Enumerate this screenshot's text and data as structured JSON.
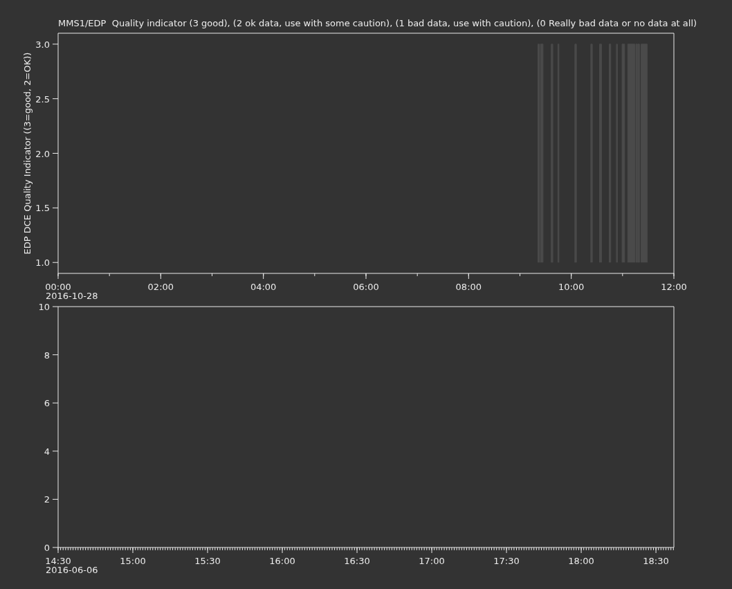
{
  "plots": [
    {
      "date_label": "2016-10-28",
      "chart_data": {
        "type": "line",
        "title": "MMS1/EDP  Quality indicator (3 good), (2 ok data, use with some caution), (1 bad data, use with caution), (0 Really bad data or no data at all)",
        "ylabel": "EDP DCE Quality Indicator ((3=good, 2=OK))",
        "xlim": [
          0,
          12
        ],
        "ylim": [
          0.9,
          3.1
        ],
        "x": [
          9.35,
          9.35,
          9.38,
          9.38,
          null,
          9.4,
          9.4,
          9.45,
          9.45,
          null,
          9.61,
          9.61,
          9.64,
          9.64,
          null,
          9.74,
          9.74,
          9.76,
          9.76,
          null,
          10.07,
          10.07,
          10.1,
          10.1,
          null,
          10.38,
          10.38,
          10.41,
          10.41,
          null,
          10.55,
          10.55,
          10.59,
          10.59,
          null,
          10.74,
          10.74,
          10.77,
          10.77,
          null,
          10.88,
          10.88,
          10.9,
          10.9,
          null,
          10.99,
          10.99,
          11.04,
          11.04,
          null,
          11.1,
          11.1,
          11.24,
          11.24,
          null,
          11.26,
          11.26,
          11.29,
          11.29,
          null,
          11.3,
          11.3,
          11.33,
          11.33,
          null,
          11.36,
          11.36,
          11.48,
          11.48
        ],
        "series": [
          {
            "color": "#4a4a4a",
            "values": [
              1,
              3,
              3,
              1,
              null,
              1,
              3,
              3,
              1,
              null,
              1,
              3,
              3,
              1,
              null,
              1,
              3,
              3,
              1,
              null,
              1,
              3,
              3,
              1,
              null,
              1,
              3,
              3,
              1,
              null,
              1,
              3,
              3,
              1,
              null,
              1,
              3,
              3,
              1,
              null,
              1,
              3,
              3,
              1,
              null,
              1,
              3,
              3,
              1,
              null,
              1,
              3,
              3,
              1,
              null,
              1,
              3,
              3,
              1,
              null,
              1,
              3,
              3,
              1,
              null,
              1,
              3,
              3,
              1
            ]
          }
        ],
        "xticks": [
          {
            "value": 0,
            "label": "00:00"
          },
          {
            "value": 2,
            "label": "02:00"
          },
          {
            "value": 4,
            "label": "04:00"
          },
          {
            "value": 6,
            "label": "06:00"
          },
          {
            "value": 8,
            "label": "08:00"
          },
          {
            "value": 10,
            "label": "10:00"
          },
          {
            "value": 12,
            "label": "12:00"
          }
        ],
        "yticks": [
          {
            "value": 1,
            "label": "1.0"
          },
          {
            "value": 1.5,
            "label": "1.5"
          },
          {
            "value": 2,
            "label": "2.0"
          },
          {
            "value": 2.5,
            "label": "2.5"
          },
          {
            "value": 3,
            "label": "3.0"
          }
        ]
      }
    },
    {
      "date_label": "2016-06-06",
      "chart_data": {
        "type": "line",
        "xlim": [
          14.5,
          18.62
        ],
        "ylim": [
          0,
          10
        ],
        "xticks": [
          {
            "value": 14.5,
            "label": "14:30"
          },
          {
            "value": 15,
            "label": "15:00"
          },
          {
            "value": 15.5,
            "label": "15:30"
          },
          {
            "value": 16,
            "label": "16:00"
          },
          {
            "value": 16.5,
            "label": "16:30"
          },
          {
            "value": 17,
            "label": "17:00"
          },
          {
            "value": 17.5,
            "label": "17:30"
          },
          {
            "value": 18,
            "label": "18:00"
          },
          {
            "value": 18.5,
            "label": "18:30"
          }
        ],
        "yticks": [
          0,
          2,
          4,
          6,
          8,
          10
        ]
      }
    }
  ]
}
